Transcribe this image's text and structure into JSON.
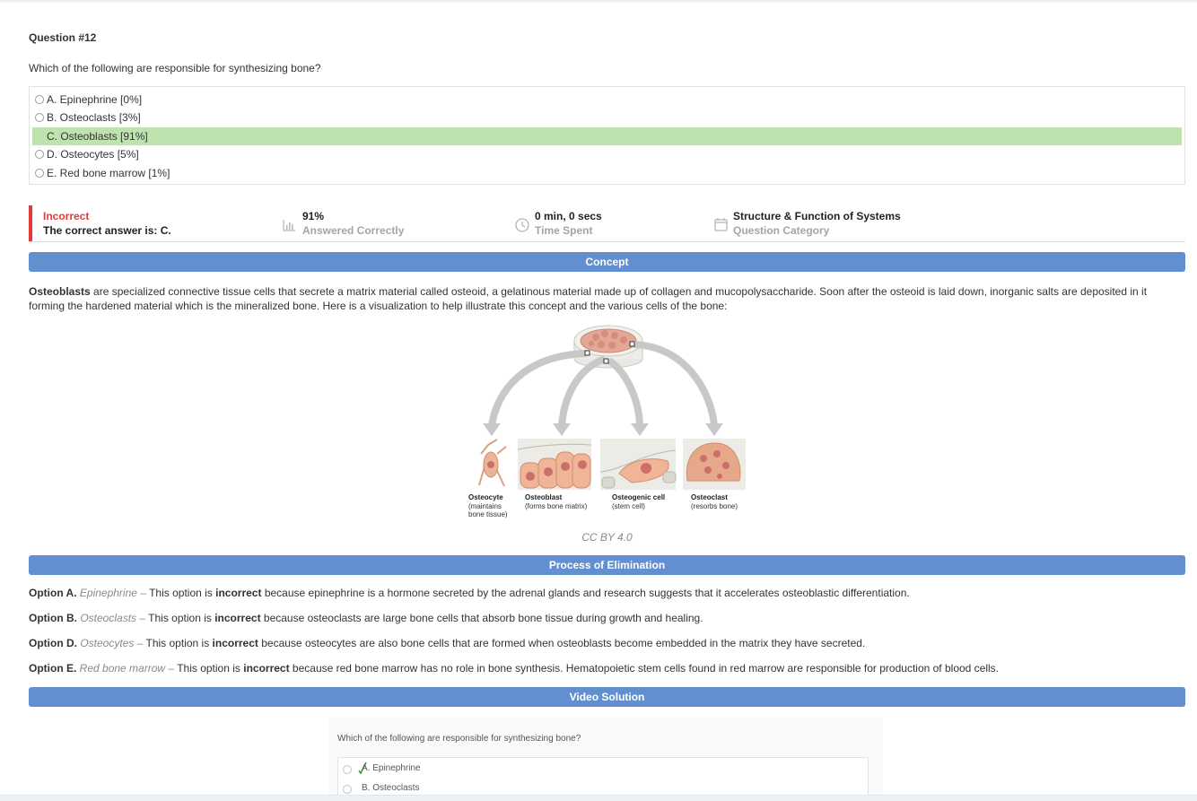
{
  "question": {
    "number_label": "Question #12",
    "text": "Which of the following are responsible for synthesizing bone?",
    "choices": [
      {
        "label": "A. Epinephrine [0%]",
        "correct": false
      },
      {
        "label": "B. Osteoclasts [3%]",
        "correct": false
      },
      {
        "label": "C. Osteoblasts [91%]",
        "correct": true
      },
      {
        "label": "D. Osteocytes [5%]",
        "correct": false
      },
      {
        "label": "E. Red bone marrow [1%]",
        "correct": false
      }
    ]
  },
  "result": {
    "status": "Incorrect",
    "correct_answer": "The correct answer is: C.",
    "percent": "91%",
    "percent_label": "Answered Correctly",
    "time": "0 min, 0 secs",
    "time_label": "Time Spent",
    "category": "Structure & Function of Systems",
    "category_label": "Question Category"
  },
  "concept": {
    "header": "Concept",
    "bold_term": "Osteoblasts",
    "line1_rest": " are specialized connective tissue cells that secrete a matrix material called osteoid, a gelatinous material made up of collagen and mucopolysaccharide. Soon after the osteoid is laid down, inorganic salts are deposited in it",
    "line2": "forming the hardened material which is the mineralized bone. Here is a visualization to help illustrate this concept and the various cells of the bone:",
    "figure_labels": [
      {
        "name": "Osteocyte",
        "desc1": "(maintains",
        "desc2": "bone tissue)"
      },
      {
        "name": "Osteoblast",
        "desc1": "(forms bone matrix)",
        "desc2": ""
      },
      {
        "name": "Osteogenic cell",
        "desc1": "(stem cell)",
        "desc2": ""
      },
      {
        "name": "Osteoclast",
        "desc1": "(resorbs bone)",
        "desc2": ""
      }
    ],
    "credit": "CC BY 4.0"
  },
  "elimination": {
    "header": "Process of Elimination",
    "options": [
      {
        "prefix": "Option A.",
        "name": "Epinephrine",
        "dash": " – This option is ",
        "verdict": "incorrect",
        "rest": " because epinephrine is a hormone secreted by the adrenal glands and research suggests that it accelerates osteoblastic differentiation."
      },
      {
        "prefix": "Option B.",
        "name": "Osteoclasts",
        "dash": " – This option is ",
        "verdict": "incorrect",
        "rest": " because osteoclasts are large bone cells that absorb bone tissue during growth and healing."
      },
      {
        "prefix": "Option D.",
        "name": "Osteocytes",
        "dash": " – This option is ",
        "verdict": "incorrect",
        "rest": " because osteocytes are also bone cells that are formed when osteoblasts become embedded in the matrix they have secreted."
      },
      {
        "prefix": "Option E.",
        "name": "Red bone marrow",
        "dash": " – This option is ",
        "verdict": "incorrect",
        "rest": " because red bone marrow has no role in bone synthesis. Hematopoietic stem cells found in red marrow are responsible for production of blood cells."
      }
    ]
  },
  "video": {
    "header": "Video Solution",
    "question": "Which of the following are responsible for synthesizing bone?",
    "rows": [
      "A. Epinephrine",
      "B. Osteoclasts"
    ]
  },
  "colors": {
    "accent": "#628fcf",
    "correct_bg": "#bfe3ae",
    "incorrect": "#e53935"
  }
}
